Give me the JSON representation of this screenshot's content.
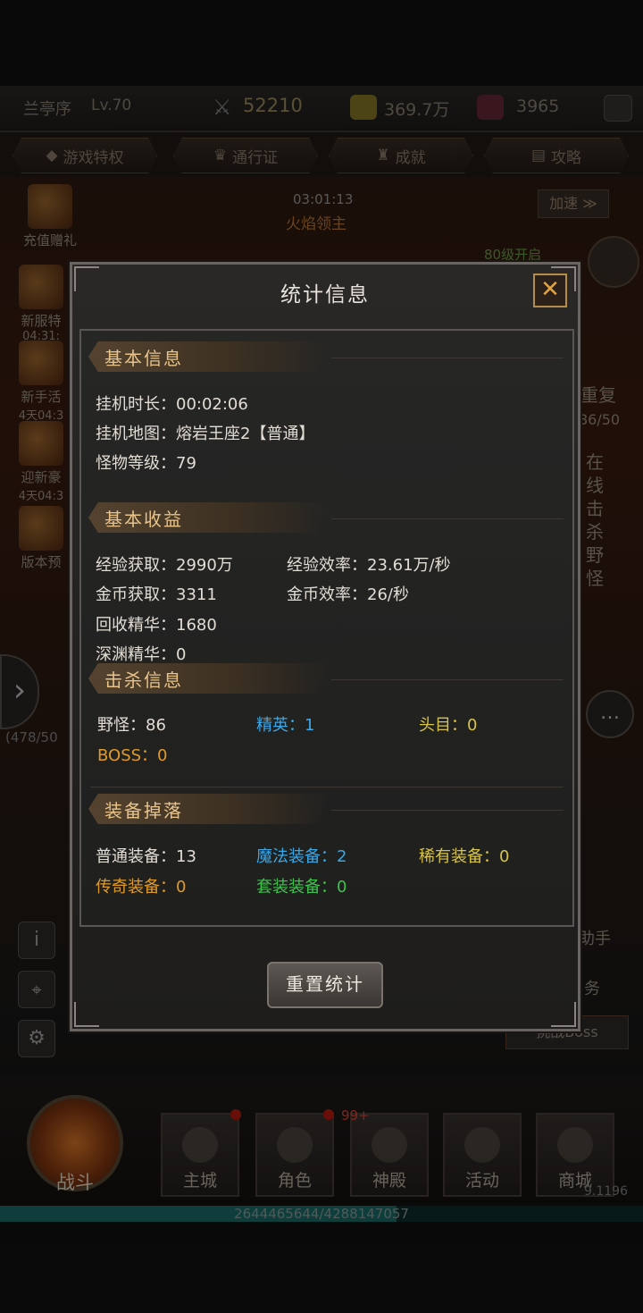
{
  "topbar": {
    "player_name": "兰亭序",
    "level": "Lv.70",
    "power": "52210",
    "gold": "369.7万",
    "gems": "3965"
  },
  "tabs": [
    "游戏特权",
    "通行证",
    "成就",
    "攻略"
  ],
  "timer": "03:01:13",
  "boss_name": "火焰领主",
  "speed_btn": "加速 ≫",
  "unlock_text": "80级开启",
  "side_left": [
    {
      "label": "充值赠礼",
      "time": ""
    },
    {
      "label": "新服特",
      "time": "04:31:"
    },
    {
      "label": "新手活",
      "time": "4天04:3"
    },
    {
      "label": "迎新豪",
      "time": "4天04:3"
    },
    {
      "label": "版本预",
      "time": ""
    }
  ],
  "side_right": {
    "repeat": "重复",
    "progress": "86/50",
    "quest": "在线击杀野怪"
  },
  "side_left_counter": "(478/50",
  "side_bottom_labels": {
    "challenge_boss": "挑战Boss",
    "helper": "助手",
    "task": "务"
  },
  "bottom_nav": [
    "战斗",
    "主城",
    "角色",
    "神殿",
    "活动",
    "商城"
  ],
  "badge_count": "99+",
  "version": "9.1196",
  "exp_text": "2644465644/4288147057",
  "exp_fraction": 0.617,
  "dialog": {
    "title": "统计信息",
    "close_icon": "✕",
    "basic_info": {
      "header": "基本信息",
      "idle_time": "挂机时长：00:02:06",
      "idle_map": "挂机地图：熔岩王座2【普通】",
      "monster_level": "怪物等级：79"
    },
    "earnings": {
      "header": "基本收益",
      "exp_gain": "经验获取：2990万",
      "exp_rate": "经验效率：23.61万/秒",
      "gold_gain": "金币获取：3311",
      "gold_rate": "金币效率：26/秒",
      "recycle": "回收精华：1680",
      "abyss": "深渊精华：0"
    },
    "kills": {
      "header": "击杀信息",
      "wild": "野怪：86",
      "elite": "精英：1",
      "chief": "头目：0",
      "boss": "BOSS：0"
    },
    "drops": {
      "header": "装备掉落",
      "normal": "普通装备：13",
      "magic": "魔法装备：2",
      "rare": "稀有装备：0",
      "legend": "传奇装备：0",
      "set": "套装装备：0"
    },
    "reset_label": "重置统计"
  }
}
